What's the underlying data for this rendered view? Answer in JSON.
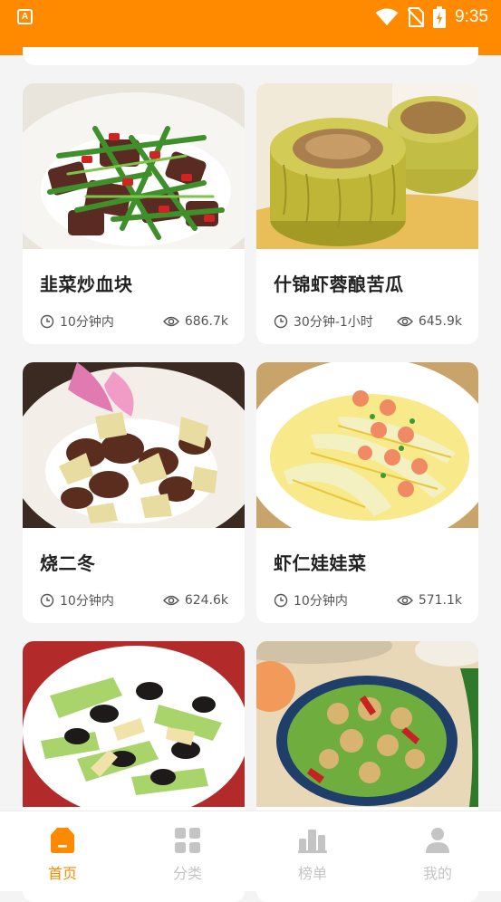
{
  "status_bar": {
    "time": "9:35",
    "app_icon_letter": "A",
    "icons": [
      "wifi-icon",
      "no-sim-icon",
      "battery-charging-icon"
    ]
  },
  "colors": {
    "accent": "#ff8a00",
    "nav_inactive": "#c4c4c4",
    "text": "#222222",
    "meta": "#555555"
  },
  "recipes": [
    {
      "title": "韭菜炒血块",
      "time": "10分钟内",
      "views": "686.7k",
      "image": "chive-blood-tofu-photo"
    },
    {
      "title": "什锦虾蓉酿苦瓜",
      "time": "30分钟-1小时",
      "views": "645.9k",
      "image": "stuffed-bitter-melon-photo"
    },
    {
      "title": "烧二冬",
      "time": "10分钟内",
      "views": "624.6k",
      "image": "braised-mushroom-bamboo-photo"
    },
    {
      "title": "虾仁娃娃菜",
      "time": "10分钟内",
      "views": "571.1k",
      "image": "shrimp-baby-cabbage-photo"
    },
    {
      "image": "mushroom-celery-bamboo-photo"
    },
    {
      "image": "walnut-bitter-melon-photo"
    }
  ],
  "bottom_nav": [
    {
      "label": "首页",
      "icon": "home-icon",
      "active": true
    },
    {
      "label": "分类",
      "icon": "grid-icon",
      "active": false
    },
    {
      "label": "榜单",
      "icon": "ranking-icon",
      "active": false
    },
    {
      "label": "我的",
      "icon": "profile-icon",
      "active": false
    }
  ]
}
